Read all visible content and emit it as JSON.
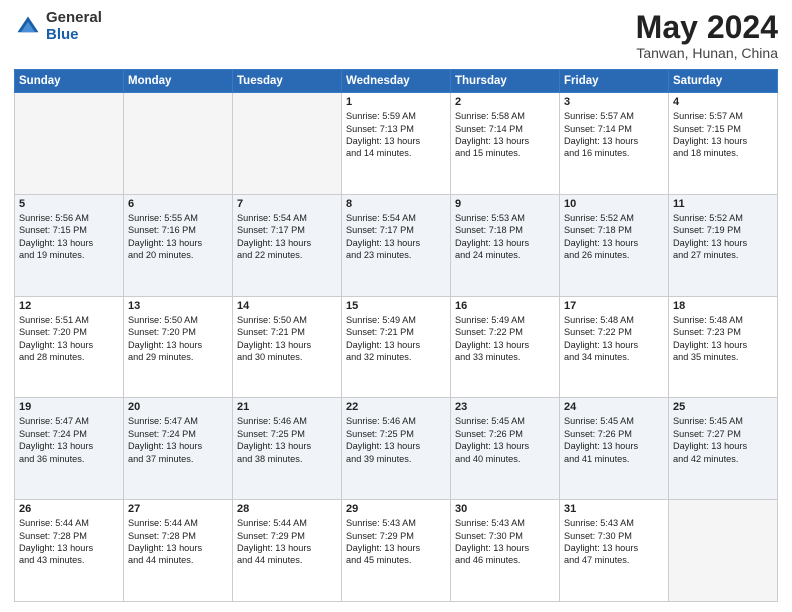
{
  "header": {
    "logo_general": "General",
    "logo_blue": "Blue",
    "title": "May 2024",
    "location": "Tanwan, Hunan, China"
  },
  "days_of_week": [
    "Sunday",
    "Monday",
    "Tuesday",
    "Wednesday",
    "Thursday",
    "Friday",
    "Saturday"
  ],
  "weeks": [
    [
      {
        "day": "",
        "info": ""
      },
      {
        "day": "",
        "info": ""
      },
      {
        "day": "",
        "info": ""
      },
      {
        "day": "1",
        "info": "Sunrise: 5:59 AM\nSunset: 7:13 PM\nDaylight: 13 hours\nand 14 minutes."
      },
      {
        "day": "2",
        "info": "Sunrise: 5:58 AM\nSunset: 7:14 PM\nDaylight: 13 hours\nand 15 minutes."
      },
      {
        "day": "3",
        "info": "Sunrise: 5:57 AM\nSunset: 7:14 PM\nDaylight: 13 hours\nand 16 minutes."
      },
      {
        "day": "4",
        "info": "Sunrise: 5:57 AM\nSunset: 7:15 PM\nDaylight: 13 hours\nand 18 minutes."
      }
    ],
    [
      {
        "day": "5",
        "info": "Sunrise: 5:56 AM\nSunset: 7:15 PM\nDaylight: 13 hours\nand 19 minutes."
      },
      {
        "day": "6",
        "info": "Sunrise: 5:55 AM\nSunset: 7:16 PM\nDaylight: 13 hours\nand 20 minutes."
      },
      {
        "day": "7",
        "info": "Sunrise: 5:54 AM\nSunset: 7:17 PM\nDaylight: 13 hours\nand 22 minutes."
      },
      {
        "day": "8",
        "info": "Sunrise: 5:54 AM\nSunset: 7:17 PM\nDaylight: 13 hours\nand 23 minutes."
      },
      {
        "day": "9",
        "info": "Sunrise: 5:53 AM\nSunset: 7:18 PM\nDaylight: 13 hours\nand 24 minutes."
      },
      {
        "day": "10",
        "info": "Sunrise: 5:52 AM\nSunset: 7:18 PM\nDaylight: 13 hours\nand 26 minutes."
      },
      {
        "day": "11",
        "info": "Sunrise: 5:52 AM\nSunset: 7:19 PM\nDaylight: 13 hours\nand 27 minutes."
      }
    ],
    [
      {
        "day": "12",
        "info": "Sunrise: 5:51 AM\nSunset: 7:20 PM\nDaylight: 13 hours\nand 28 minutes."
      },
      {
        "day": "13",
        "info": "Sunrise: 5:50 AM\nSunset: 7:20 PM\nDaylight: 13 hours\nand 29 minutes."
      },
      {
        "day": "14",
        "info": "Sunrise: 5:50 AM\nSunset: 7:21 PM\nDaylight: 13 hours\nand 30 minutes."
      },
      {
        "day": "15",
        "info": "Sunrise: 5:49 AM\nSunset: 7:21 PM\nDaylight: 13 hours\nand 32 minutes."
      },
      {
        "day": "16",
        "info": "Sunrise: 5:49 AM\nSunset: 7:22 PM\nDaylight: 13 hours\nand 33 minutes."
      },
      {
        "day": "17",
        "info": "Sunrise: 5:48 AM\nSunset: 7:22 PM\nDaylight: 13 hours\nand 34 minutes."
      },
      {
        "day": "18",
        "info": "Sunrise: 5:48 AM\nSunset: 7:23 PM\nDaylight: 13 hours\nand 35 minutes."
      }
    ],
    [
      {
        "day": "19",
        "info": "Sunrise: 5:47 AM\nSunset: 7:24 PM\nDaylight: 13 hours\nand 36 minutes."
      },
      {
        "day": "20",
        "info": "Sunrise: 5:47 AM\nSunset: 7:24 PM\nDaylight: 13 hours\nand 37 minutes."
      },
      {
        "day": "21",
        "info": "Sunrise: 5:46 AM\nSunset: 7:25 PM\nDaylight: 13 hours\nand 38 minutes."
      },
      {
        "day": "22",
        "info": "Sunrise: 5:46 AM\nSunset: 7:25 PM\nDaylight: 13 hours\nand 39 minutes."
      },
      {
        "day": "23",
        "info": "Sunrise: 5:45 AM\nSunset: 7:26 PM\nDaylight: 13 hours\nand 40 minutes."
      },
      {
        "day": "24",
        "info": "Sunrise: 5:45 AM\nSunset: 7:26 PM\nDaylight: 13 hours\nand 41 minutes."
      },
      {
        "day": "25",
        "info": "Sunrise: 5:45 AM\nSunset: 7:27 PM\nDaylight: 13 hours\nand 42 minutes."
      }
    ],
    [
      {
        "day": "26",
        "info": "Sunrise: 5:44 AM\nSunset: 7:28 PM\nDaylight: 13 hours\nand 43 minutes."
      },
      {
        "day": "27",
        "info": "Sunrise: 5:44 AM\nSunset: 7:28 PM\nDaylight: 13 hours\nand 44 minutes."
      },
      {
        "day": "28",
        "info": "Sunrise: 5:44 AM\nSunset: 7:29 PM\nDaylight: 13 hours\nand 44 minutes."
      },
      {
        "day": "29",
        "info": "Sunrise: 5:43 AM\nSunset: 7:29 PM\nDaylight: 13 hours\nand 45 minutes."
      },
      {
        "day": "30",
        "info": "Sunrise: 5:43 AM\nSunset: 7:30 PM\nDaylight: 13 hours\nand 46 minutes."
      },
      {
        "day": "31",
        "info": "Sunrise: 5:43 AM\nSunset: 7:30 PM\nDaylight: 13 hours\nand 47 minutes."
      },
      {
        "day": "",
        "info": ""
      }
    ]
  ]
}
